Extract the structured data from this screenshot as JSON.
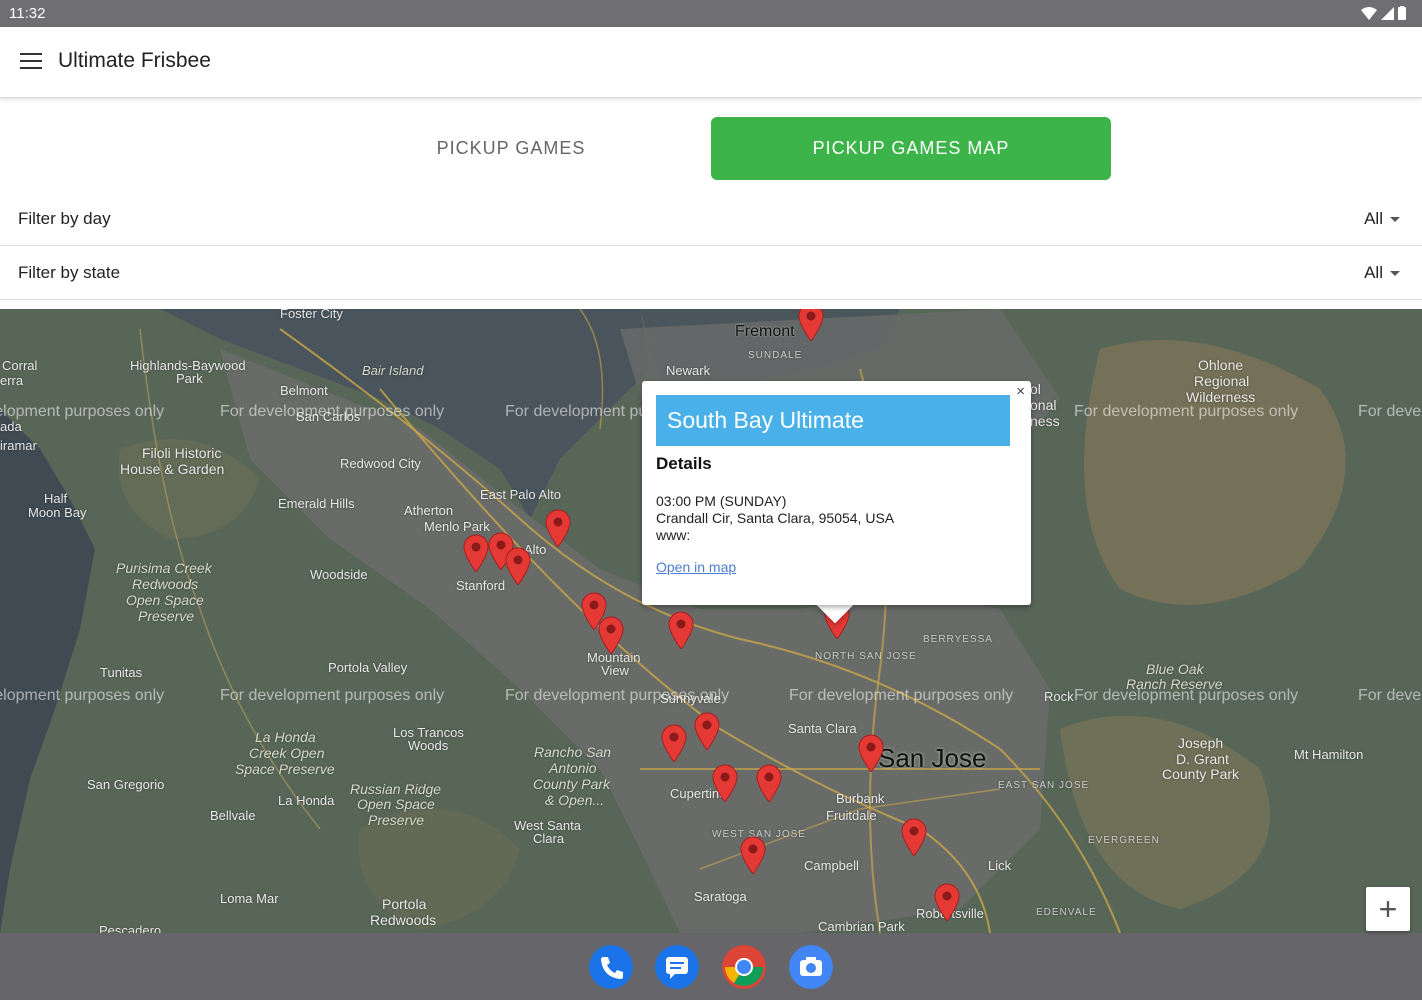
{
  "status_bar": {
    "time": "11:32"
  },
  "app_bar": {
    "title": "Ultimate Frisbee"
  },
  "tabs": [
    {
      "label": "PICKUP GAMES",
      "selected": false
    },
    {
      "label": "PICKUP GAMES MAP",
      "selected": true
    }
  ],
  "filters": {
    "day": {
      "label": "Filter by day",
      "value": "All"
    },
    "state": {
      "label": "Filter by state",
      "value": "All"
    }
  },
  "map": {
    "watermark": "For development purposes only",
    "labels": {
      "fremont": "Fremont",
      "sundale": "SUNDALE",
      "newark": "Newark",
      "foster_city": "Foster City",
      "corral": "Corral",
      "erra": "erra",
      "ada": "ada",
      "iramar": "iramar",
      "highlands": "Highlands-Baywood",
      "park": "Park",
      "bair_island": "Bair Island",
      "belmont": "Belmont",
      "san_carlos": "San Carlos",
      "redwood_city": "Redwood City",
      "filoli": "Filoli Historic",
      "house_garden": "House & Garden",
      "half": "Half",
      "moon_bay": "Moon Bay",
      "emerald_hills": "Emerald Hills",
      "atherton": "Atherton",
      "menlo_park": "Menlo Park",
      "east_palo_alto": "East Palo Alto",
      "palo_alto": "Alto",
      "stanford": "Stanford",
      "woodside": "Woodside",
      "purisima1": "Purisima Creek",
      "purisima2": "Redwoods",
      "purisima3": "Open Space",
      "purisima4": "Preserve",
      "tunitas": "Tunitas",
      "portola_valley": "Portola Valley",
      "mountain": "Mountain",
      "view": "View",
      "sunnyvale": "Sunnyvale",
      "santa_clara": "Santa Clara",
      "san_jose": "San Jose",
      "north_san_jose": "NORTH SAN JOSE",
      "berryessa": "BERRYESSA",
      "east_san_jose": "EAST SAN JOSE",
      "evergreen": "EVERGREEN",
      "edenvale": "EDENVALE",
      "ohlone1": "Ohlone",
      "ohlone2": "Regional",
      "ohlone3": "Wilderness",
      "blue_oak1": "Blue Oak",
      "blue_oak2": "Ranch Reserve",
      "joseph1": "Joseph",
      "joseph2": "D. Grant",
      "joseph3": "County Park",
      "mt_hamilton": "Mt Hamilton",
      "rock": "Rock",
      "los_trancos1": "Los Trancos",
      "los_trancos2": "Woods",
      "la_honda_creek1": "La Honda",
      "la_honda_creek2": "Creek Open",
      "la_honda_creek3": "Space Preserve",
      "rancho1": "Rancho San",
      "rancho2": "Antonio",
      "rancho3": "County Park",
      "rancho4": "& Open...",
      "san_gregorio": "San Gregorio",
      "la_honda": "La Honda",
      "russian1": "Russian Ridge",
      "russian2": "Open Space",
      "russian3": "Preserve",
      "bellvale": "Bellvale",
      "west_santa_clara1": "West Santa",
      "west_santa_clara2": "Clara",
      "cupertino": "Cupertino",
      "west_san_jose": "WEST SAN JOSE",
      "burbank": "Burbank",
      "fruitdale": "Fruitdale",
      "campbell": "Campbell",
      "saratoga": "Saratoga",
      "lick": "Lick",
      "robertsville": "Robertsville",
      "cambrian_park": "Cambrian Park",
      "loma_mar": "Loma Mar",
      "portola1": "Portola",
      "portola2": "Redwoods",
      "pescadero": "Pescadero",
      "ness": "ness",
      "onal": "onal",
      "ol": "ol"
    }
  },
  "popup": {
    "title": "South Bay Ultimate",
    "details_heading": "Details",
    "time": "03:00 PM (SUNDAY)",
    "address": "Crandall Cir, Santa Clara, 95054, USA",
    "www": "www:",
    "link": "Open in map",
    "close": "×"
  },
  "zoom_in": "+",
  "colors": {
    "accent_green": "#3db44a",
    "popup_header": "#4ab0ea",
    "pin_red": "#e53935"
  }
}
